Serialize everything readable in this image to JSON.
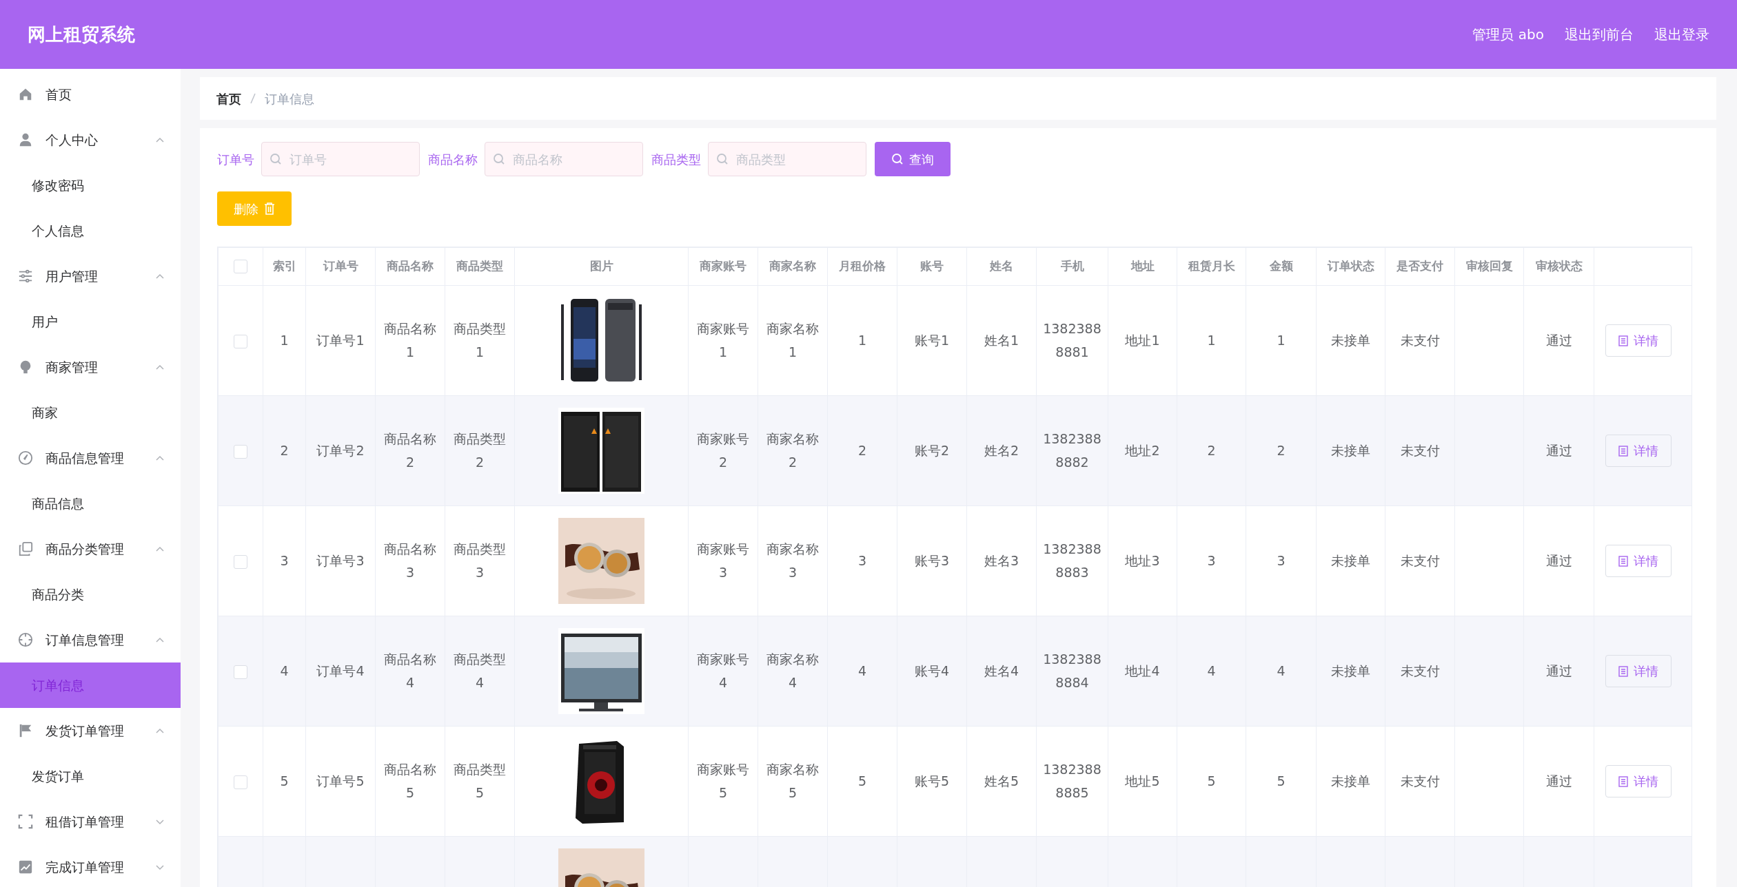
{
  "header": {
    "title": "网上租贸系统",
    "links": [
      "管理员 abo",
      "退出到前台",
      "退出登录"
    ]
  },
  "sidebar": {
    "items": [
      {
        "label": "首页",
        "selected": false
      },
      {
        "label": "个人中心",
        "selected": false,
        "expanded": true,
        "children": [
          {
            "label": "修改密码",
            "selected": false
          },
          {
            "label": "个人信息",
            "selected": false
          }
        ]
      },
      {
        "label": "用户管理",
        "selected": false,
        "expanded": true,
        "children": [
          {
            "label": "用户",
            "selected": false
          }
        ]
      },
      {
        "label": "商家管理",
        "selected": false,
        "expanded": true,
        "children": [
          {
            "label": "商家",
            "selected": false
          }
        ]
      },
      {
        "label": "商品信息管理",
        "selected": false,
        "expanded": true,
        "children": [
          {
            "label": "商品信息",
            "selected": false
          }
        ]
      },
      {
        "label": "商品分类管理",
        "selected": false,
        "expanded": true,
        "children": [
          {
            "label": "商品分类",
            "selected": false
          }
        ]
      },
      {
        "label": "订单信息管理",
        "selected": false,
        "expanded": true,
        "children": [
          {
            "label": "订单信息",
            "selected": true
          }
        ]
      },
      {
        "label": "发货订单管理",
        "selected": false,
        "expanded": true,
        "children": [
          {
            "label": "发货订单",
            "selected": false
          }
        ]
      },
      {
        "label": "租借订单管理",
        "selected": false,
        "expanded": false
      },
      {
        "label": "完成订单管理",
        "selected": false,
        "expanded": false
      }
    ]
  },
  "breadcrumb": [
    "首页",
    "订单信息"
  ],
  "search": {
    "fields": [
      {
        "label": "订单号",
        "placeholder": "订单号"
      },
      {
        "label": "商品名称",
        "placeholder": "商品名称"
      },
      {
        "label": "商品类型",
        "placeholder": "商品类型"
      }
    ],
    "button": "查询"
  },
  "delete_button": "删除",
  "table": {
    "select_all_checked": false,
    "columns": [
      "索引",
      "订单号",
      "商品名称",
      "商品类型",
      "图片",
      "商家账号",
      "商家名称",
      "月租价格",
      "账号",
      "姓名",
      "手机",
      "地址",
      "租赁月长",
      "金额",
      "订单状态",
      "是否支付",
      "审核回复",
      "审核状态"
    ],
    "rows": [
      {
        "checked": false,
        "cells": [
          "1",
          "订单号1",
          "商品名称1",
          "商品类型1",
          null,
          "商家账号1",
          "商家名称1",
          "1",
          "账号1",
          "姓名1",
          "13823888881",
          "地址1",
          "1",
          "1",
          "未接单",
          "未支付",
          null,
          "通过"
        ],
        "action": "详情"
      },
      {
        "checked": false,
        "cells": [
          "2",
          "订单号2",
          "商品名称2",
          "商品类型2",
          null,
          "商家账号2",
          "商家名称2",
          "2",
          "账号2",
          "姓名2",
          "13823888882",
          "地址2",
          "2",
          "2",
          "未接单",
          "未支付",
          null,
          "通过"
        ],
        "action": "详情"
      },
      {
        "checked": false,
        "cells": [
          "3",
          "订单号3",
          "商品名称3",
          "商品类型3",
          null,
          "商家账号3",
          "商家名称3",
          "3",
          "账号3",
          "姓名3",
          "13823888883",
          "地址3",
          "3",
          "3",
          "未接单",
          "未支付",
          null,
          "通过"
        ],
        "action": "详情"
      },
      {
        "checked": false,
        "cells": [
          "4",
          "订单号4",
          "商品名称4",
          "商品类型4",
          null,
          "商家账号4",
          "商家名称4",
          "4",
          "账号4",
          "姓名4",
          "13823888884",
          "地址4",
          "4",
          "4",
          "未接单",
          "未支付",
          null,
          "通过"
        ],
        "action": "详情"
      },
      {
        "checked": false,
        "cells": [
          "5",
          "订单号5",
          "商品名称5",
          "商品类型5",
          null,
          "商家账号5",
          "商家名称5",
          "5",
          "账号5",
          "姓名5",
          "13823888885",
          "地址5",
          "5",
          "5",
          "未接单",
          "未支付",
          null,
          "通过"
        ],
        "action": "详情"
      }
    ]
  }
}
